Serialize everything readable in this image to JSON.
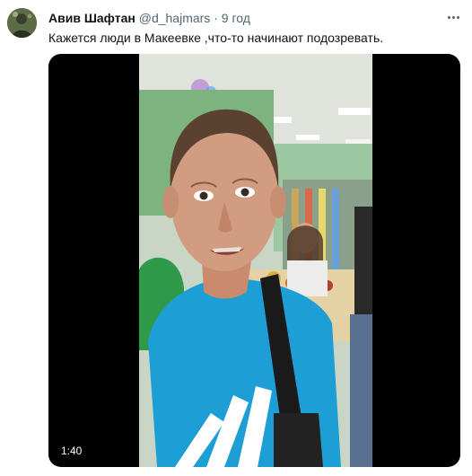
{
  "tweet": {
    "author": {
      "display_name": "Авив Шафтан",
      "handle": "@d_hajmars",
      "separator": "·",
      "time": "9 год"
    },
    "text": "Кажется люди в Макеевке ,что-то начинают подозревать.",
    "avatar_icon": "avatar-icon",
    "more_icon": "more-horizontal-icon",
    "video": {
      "duration": "1:40"
    }
  }
}
